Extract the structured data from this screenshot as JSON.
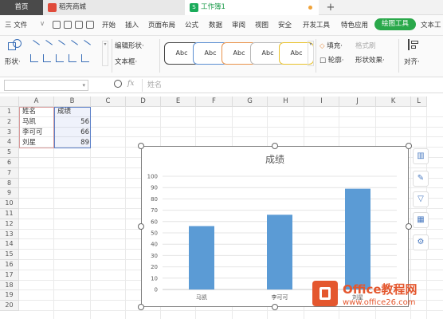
{
  "tabs": {
    "home": "首页",
    "shop": "稻壳商城",
    "book": "工作簿1",
    "add": "+"
  },
  "menu": {
    "file": "三 文件",
    "file_caret": "∨",
    "items": [
      "开始",
      "插入",
      "页面布局",
      "公式",
      "数据",
      "审阅",
      "视图",
      "安全",
      "开发工具",
      "特色应用"
    ],
    "active": "绘图工具",
    "overflow": "文本工"
  },
  "ribbon": {
    "shapes_label": "形状·",
    "edit_shape": "编辑形状·",
    "text_box": "文本框·",
    "style_samples": [
      "Abc",
      "Abc",
      "Abc",
      "Abc",
      "Abc"
    ],
    "fill": "填充·",
    "format_painter": "格式刷",
    "outline": "轮廓·",
    "shape_effect": "形状效果·",
    "align": "对齐·"
  },
  "formula_bar": {
    "fx": "fx",
    "value": "姓名"
  },
  "columns": [
    "A",
    "B",
    "C",
    "D",
    "E",
    "F",
    "G",
    "H",
    "I",
    "J",
    "K",
    "L"
  ],
  "rows": [
    "1",
    "2",
    "3",
    "4",
    "5",
    "6",
    "7",
    "8",
    "9",
    "10",
    "11",
    "12",
    "13",
    "14",
    "15",
    "16",
    "17",
    "18",
    "19",
    "20"
  ],
  "table": {
    "header": [
      "姓名",
      "成绩"
    ],
    "rows": [
      [
        "马凯",
        "56"
      ],
      [
        "李可可",
        "66"
      ],
      [
        "刘星",
        "89"
      ]
    ]
  },
  "chart_data": {
    "type": "bar",
    "title": "成绩",
    "categories": [
      "马凯",
      "李可可",
      "刘星"
    ],
    "values": [
      56,
      66,
      89
    ],
    "ylim": [
      0,
      100
    ],
    "yticks": [
      "0",
      "10",
      "20",
      "30",
      "40",
      "50",
      "60",
      "70",
      "80",
      "90",
      "100"
    ],
    "grid": true,
    "bar_color": "#5b9bd5"
  },
  "watermark": {
    "name": "Office教程网",
    "url": "www.office26.com"
  },
  "colors": {
    "accent_green": "#2aa84a",
    "chart_bar": "#5b9bd5",
    "watermark": "#e4572e"
  }
}
